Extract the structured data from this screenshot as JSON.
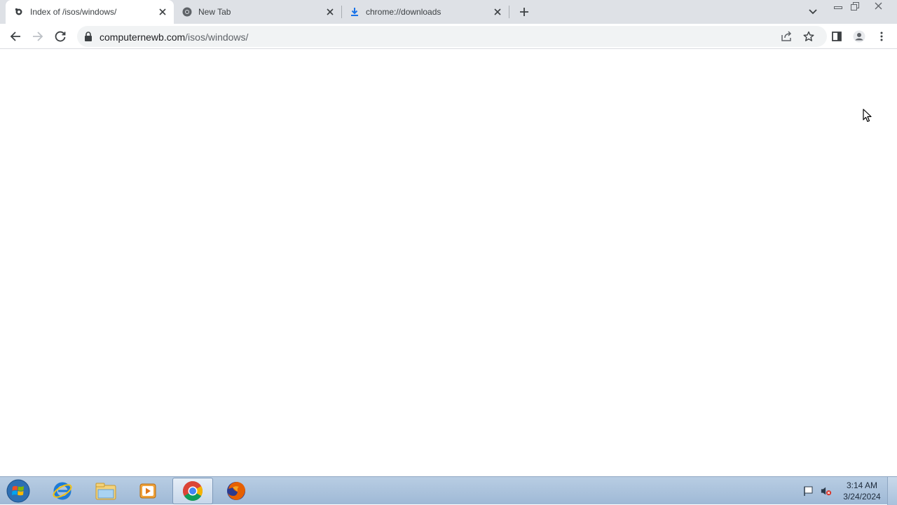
{
  "browser": {
    "tabs": [
      {
        "title": "Index of /isos/windows/",
        "favicon": "site-favicon",
        "active": true
      },
      {
        "title": "New Tab",
        "favicon": "chrome-icon",
        "active": false
      },
      {
        "title": "chrome://downloads",
        "favicon": "download-icon",
        "active": false
      }
    ],
    "omnibox": {
      "domain": "computernewb.com",
      "path": "/isos/windows/"
    }
  },
  "taskbar": {
    "apps": [
      "start-orb",
      "internet-explorer-icon",
      "windows-explorer-icon",
      "media-player-icon",
      "chrome-icon",
      "firefox-icon"
    ],
    "clock": {
      "time": "3:14 AM",
      "date": "3/24/2024"
    }
  },
  "colors": {
    "tabstrip": "#dee1e6",
    "omnibox": "#f1f3f4",
    "download_accent": "#1a73e8",
    "taskbar": "#a9c1dc"
  }
}
